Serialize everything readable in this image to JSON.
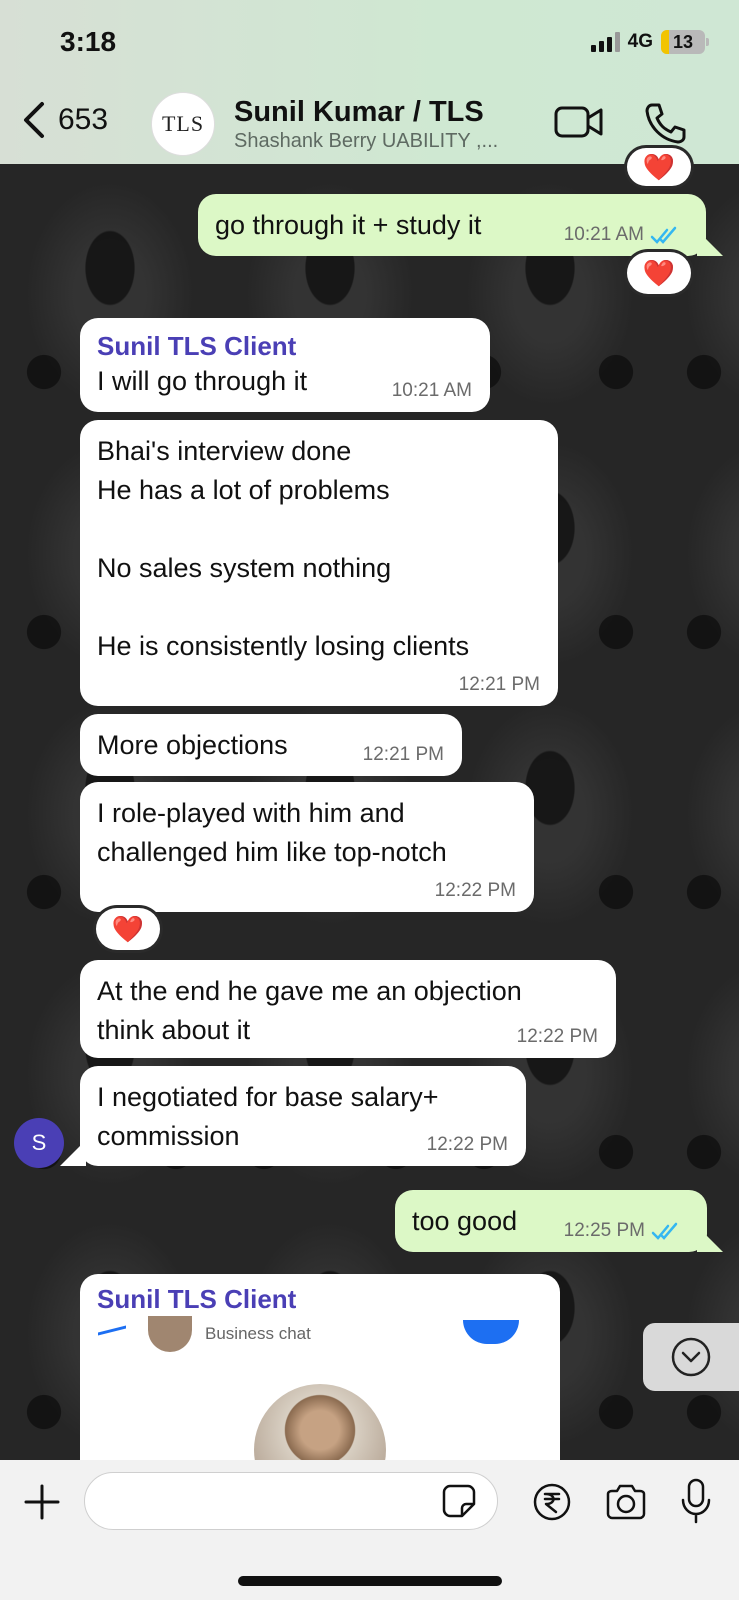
{
  "status_bar": {
    "time": "3:18",
    "network": "4G",
    "battery": "13"
  },
  "header": {
    "back_count": "653",
    "avatar_text": "TLS",
    "title": "Sunil Kumar / TLS",
    "subtitle": "Shashank Berry UABILITY ,..."
  },
  "messages": [
    {
      "direction": "out",
      "text": "go through it + study it",
      "time": "10:21 AM",
      "reaction": "❤️"
    },
    {
      "direction": "in",
      "sender": "Sunil TLS Client",
      "text": "I will go through it",
      "time": "10:21 AM"
    },
    {
      "direction": "in",
      "text": "Bhai's interview done\nHe has a lot of problems\n\nNo sales system nothing\n\nHe is consistently losing clients",
      "time": "12:21 PM"
    },
    {
      "direction": "in",
      "text": "More objections",
      "time": "12:21 PM"
    },
    {
      "direction": "in",
      "text": "I role-played with him and\nchallenged him like top-notch",
      "time": "12:22 PM",
      "reaction": "❤️"
    },
    {
      "direction": "in",
      "text": "At the end he gave me an objection\nthink about it",
      "time": "12:22 PM"
    },
    {
      "direction": "in",
      "text": "I negotiated for base salary+\ncommission",
      "time": "12:22 PM"
    },
    {
      "direction": "out",
      "text": "too good",
      "time": "12:25 PM"
    }
  ],
  "sender_avatar_letter": "S",
  "image_message": {
    "sender": "Sunil TLS Client",
    "caption": "Business chat"
  },
  "composer": {
    "placeholder": "",
    "value": ""
  },
  "colors": {
    "outgoing_bubble": "#dcf8c6",
    "incoming_bubble": "#ffffff",
    "sender_name": "#4a3fb5",
    "read_ticks": "#34b7f1"
  }
}
